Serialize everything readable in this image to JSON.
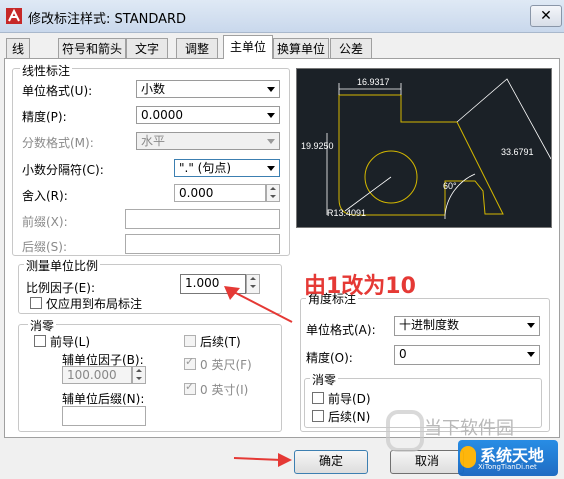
{
  "window": {
    "title": "修改标注样式: STANDARD"
  },
  "tabs": [
    {
      "label": "线",
      "active": false
    },
    {
      "label": "符号和箭头",
      "active": false
    },
    {
      "label": "文字",
      "active": false
    },
    {
      "label": "调整",
      "active": false
    },
    {
      "label": "主单位",
      "active": true
    },
    {
      "label": "换算单位",
      "active": false
    },
    {
      "label": "公差",
      "active": false
    }
  ],
  "linear": {
    "group_title": "线性标注",
    "unit_format_label": "单位格式(U):",
    "unit_format_value": "小数",
    "precision_label": "精度(P):",
    "precision_value": "0.0000",
    "fraction_format_label": "分数格式(M):",
    "fraction_format_value": "水平",
    "decimal_sep_label": "小数分隔符(C):",
    "decimal_sep_value": "\".\" (句点)",
    "round_off_label": "舍入(R):",
    "round_off_value": "0.000",
    "prefix_label": "前缀(X):",
    "prefix_value": "",
    "suffix_label": "后缀(S):",
    "suffix_value": ""
  },
  "measurement": {
    "group_title": "测量单位比例",
    "scale_label": "比例因子(E):",
    "scale_value": "1.000",
    "layout_only_label": "仅应用到布局标注"
  },
  "zero_linear": {
    "group_title": "消零",
    "leading_label": "前导(L)",
    "trailing_label": "后续(T)",
    "sub_factor_label": "辅单位因子(B):",
    "sub_factor_value": "100.000",
    "feet_label": "0 英尺(F)",
    "inches_label": "0 英寸(I)",
    "sub_suffix_label": "辅单位后缀(N):",
    "sub_suffix_value": ""
  },
  "angular": {
    "group_title": "角度标注",
    "unit_format_label": "单位格式(A):",
    "unit_format_value": "十进制度数",
    "precision_label": "精度(O):",
    "precision_value": "0",
    "zero_group_title": "消零",
    "leading_label": "前导(D)",
    "trailing_label": "后续(N)"
  },
  "preview": {
    "dim_top": "16.9317",
    "dim_left": "19.9250",
    "dim_right": "33.6791",
    "angle": "60°",
    "radius": "R13.4091"
  },
  "annotation": {
    "text": "由1改为10"
  },
  "buttons": {
    "ok": "确定",
    "cancel": "取消"
  },
  "watermark": {
    "site1": "当下软件园",
    "site2": "系统天地",
    "site2_url": "XiTongTianDi.net"
  },
  "colors": {
    "accent_red": "#e53935",
    "preview_bg": "#1b2127",
    "preview_line": "#d4b800"
  }
}
